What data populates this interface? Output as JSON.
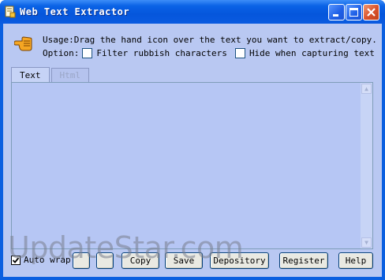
{
  "window": {
    "title": "Web Text Extractor",
    "colors": {
      "titlebar": "#0a5fe0",
      "client_bg": "#b9c8f2",
      "text_area_bg": "#b6c6f4",
      "close_button": "#d8512a"
    }
  },
  "titlebar_buttons": [
    {
      "name": "minimize",
      "icon": "minimize-icon"
    },
    {
      "name": "maximize",
      "icon": "maximize-icon"
    },
    {
      "name": "close",
      "icon": "close-icon"
    }
  ],
  "usage": {
    "text": "Usage:Drag the hand icon over the text you want to extract/copy.",
    "hand_icon": "pointing-hand-icon"
  },
  "options": {
    "label": "Option:",
    "filter_rubbish": {
      "label": "Filter rubbish characters",
      "checked": false
    },
    "hide_capturing": {
      "label": "Hide when capturing text",
      "checked": false
    }
  },
  "tabs": [
    {
      "label": "Text",
      "active": true
    },
    {
      "label": "Html",
      "active": false
    }
  ],
  "text_area": {
    "value": ""
  },
  "bottom": {
    "auto_wrap": {
      "label": "Auto wrap",
      "checked": true
    },
    "buttons": {
      "copy": "Copy",
      "save": "Save",
      "depository": "Depository",
      "register": "Register",
      "help": "Help"
    }
  },
  "watermark": "UpdateStar.com"
}
